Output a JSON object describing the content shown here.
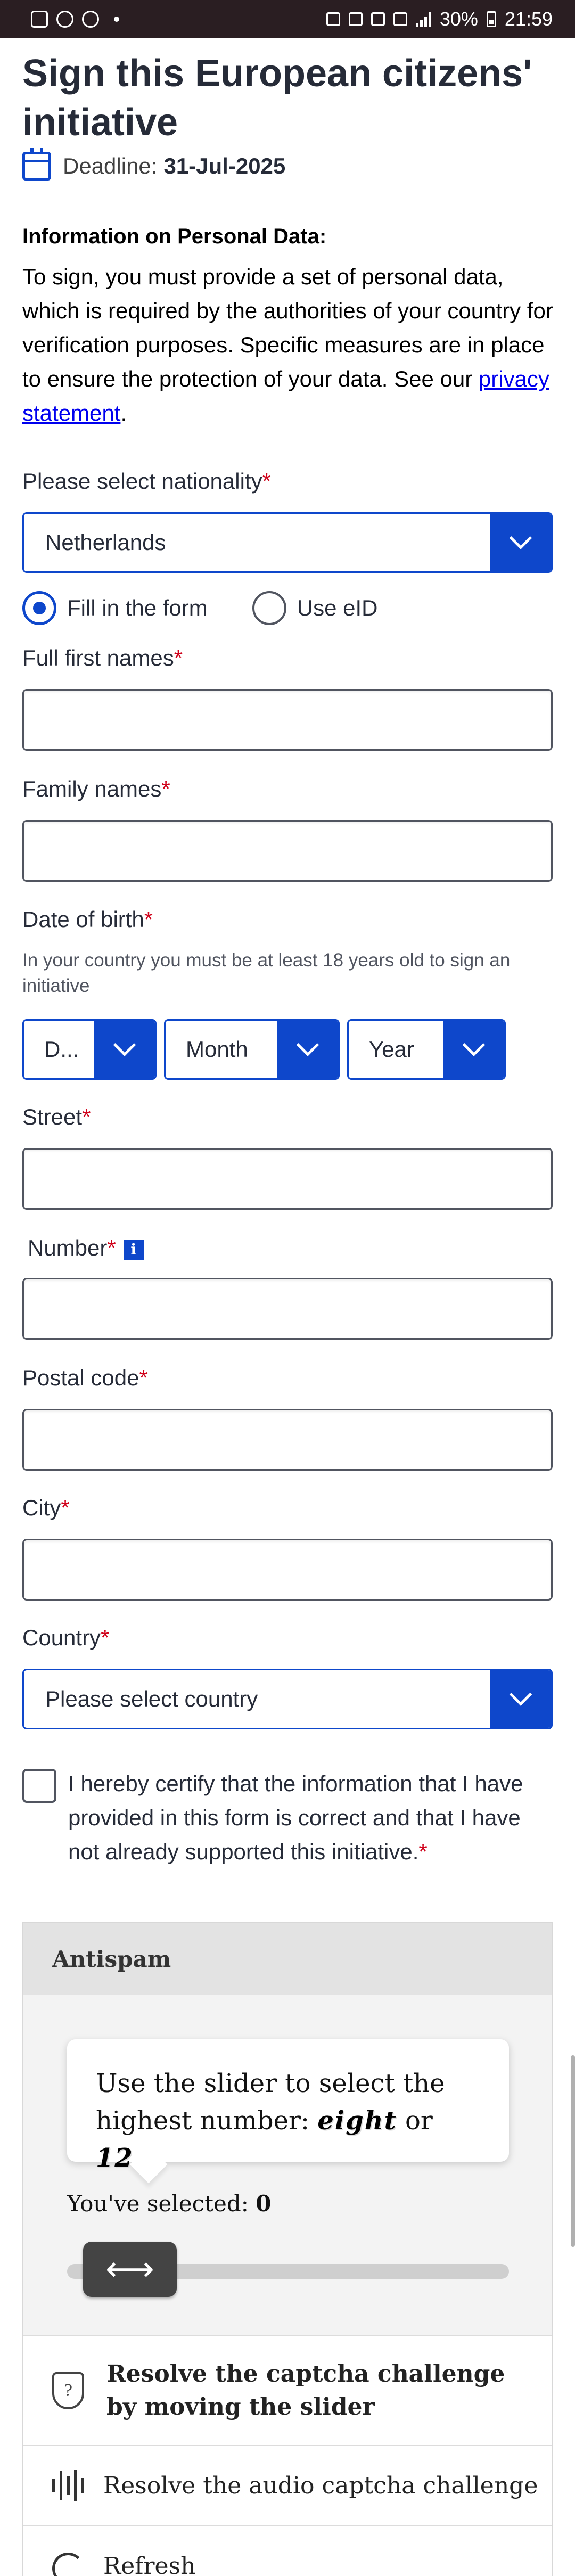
{
  "status_bar": {
    "battery": "30%",
    "time": "21:59"
  },
  "page": {
    "title": "Sign this European citizens' initiative",
    "deadline_label": "Deadline:",
    "deadline_value": "31-Jul-2025"
  },
  "personal_data": {
    "heading": "Information on Personal Data:",
    "text": "To sign, you must provide a set of personal data, which is required by the authorities of your country for verification purposes. Specific measures are in place to ensure the protection of your data. See our ",
    "link": "privacy statement",
    "end": "."
  },
  "nationality": {
    "label": "Please select nationality",
    "value": "Netherlands"
  },
  "method": {
    "option1": "Fill in the form",
    "option2": "Use eID",
    "selected": "Fill in the form"
  },
  "fields": {
    "first_names": "Full first names",
    "family_names": "Family names",
    "dob_label": "Date of birth",
    "dob_hint": "In your country you must be at least 18 years old to sign an initiative",
    "dob_day": "D...",
    "dob_month": "Month",
    "dob_year": "Year",
    "street": "Street",
    "number": "Number",
    "postal_code": "Postal code",
    "city": "City",
    "country_label": "Country",
    "country_value": "Please select country",
    "required_mark": "*"
  },
  "certification": "I hereby certify that the information that I have provided in this form is correct and that I have not already supported this initiative.",
  "antispam": {
    "heading": "Antispam",
    "instruction": "Use the slider to select the highest number:",
    "captcha_a": "eight",
    "or": "or",
    "captcha_b": "12",
    "selected_label": "You've selected:",
    "selected_value": "0",
    "handle_glyph": "⟷",
    "option_slider": "Resolve the captcha challenge by moving the slider",
    "option_audio": "Resolve the audio captcha challenge",
    "option_refresh": "Refresh"
  },
  "colors": {
    "primary": "#0e47cb",
    "required": "#d0021b",
    "text": "#262b38"
  },
  "icons": [
    "calendar-icon",
    "chevron-down-icon",
    "info-icon",
    "shield-icon",
    "audio-icon",
    "refresh-icon",
    "arrows-horizontal-icon"
  ]
}
